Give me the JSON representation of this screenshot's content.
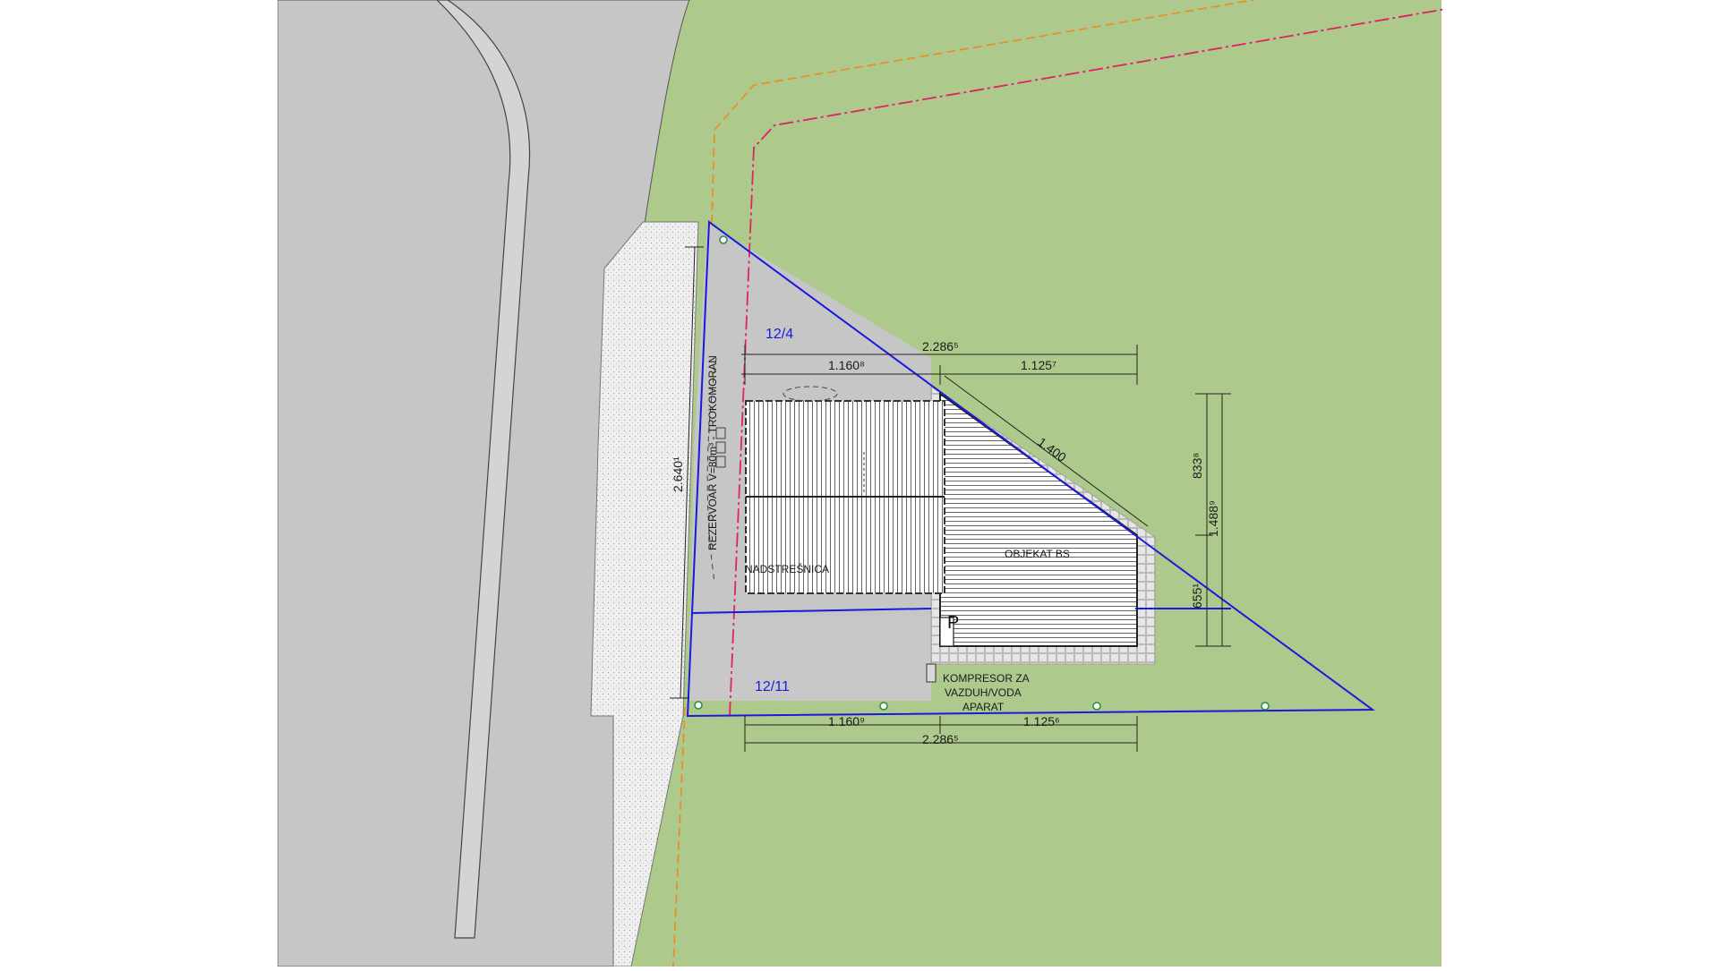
{
  "drawing": {
    "parcels": {
      "north": "12/4",
      "south": "12/11"
    },
    "labels": {
      "canopy": "NADSTREŠNICA",
      "building": "OBJEKAT BS",
      "parking": "P",
      "compressor_line1": "KOMPRESOR ZA",
      "compressor_line2": "VAZDUH/VODA",
      "compressor_line3": "APARAT",
      "tank": "REZERVOAR V=80m³ - TROKOMORAN"
    },
    "dimensions": {
      "top_total": "2.286⁵",
      "top_right": "1.125⁷",
      "top_left": "1.160⁸",
      "diagonal": "1.400",
      "right_upper": "833⁸",
      "right_total": "1.488⁹",
      "right_lower": "655¹",
      "left_vertical": "2.640¹",
      "bottom_left": "1.160⁹",
      "bottom_right": "1.125⁶",
      "bottom_total": "2.286⁵"
    },
    "colors": {
      "grass": "#adc98b",
      "road": "#c6c6c6",
      "parcel_line": "#1a1adf",
      "regulation_line": "#e0206a",
      "building_line": "#f08a1c"
    }
  }
}
